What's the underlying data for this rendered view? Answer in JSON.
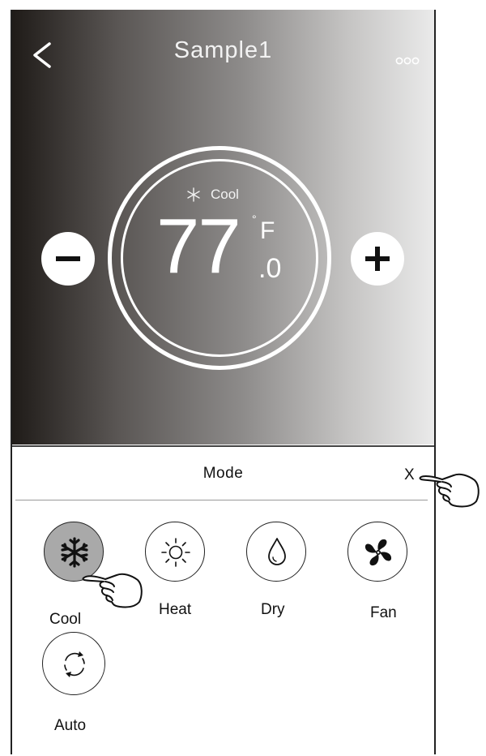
{
  "header": {
    "title": "Sample1"
  },
  "dial": {
    "mode_label": "Cool",
    "temperature": "77",
    "decimal": "0",
    "unit": "F"
  },
  "sheet": {
    "title": "Mode",
    "close_label": "X"
  },
  "modes": [
    {
      "label": "Cool",
      "icon": "snowflake-icon",
      "selected": true
    },
    {
      "label": "Heat",
      "icon": "sun-icon",
      "selected": false
    },
    {
      "label": "Dry",
      "icon": "droplet-icon",
      "selected": false
    },
    {
      "label": "Fan",
      "icon": "fan-icon",
      "selected": false
    },
    {
      "label": "Auto",
      "icon": "cycle-arrows-icon",
      "selected": false
    }
  ],
  "colors": {
    "selected_mode": "#a9a9a9",
    "header_gradient_dark": "#1f1b18",
    "header_gradient_light": "#eaeaea"
  }
}
